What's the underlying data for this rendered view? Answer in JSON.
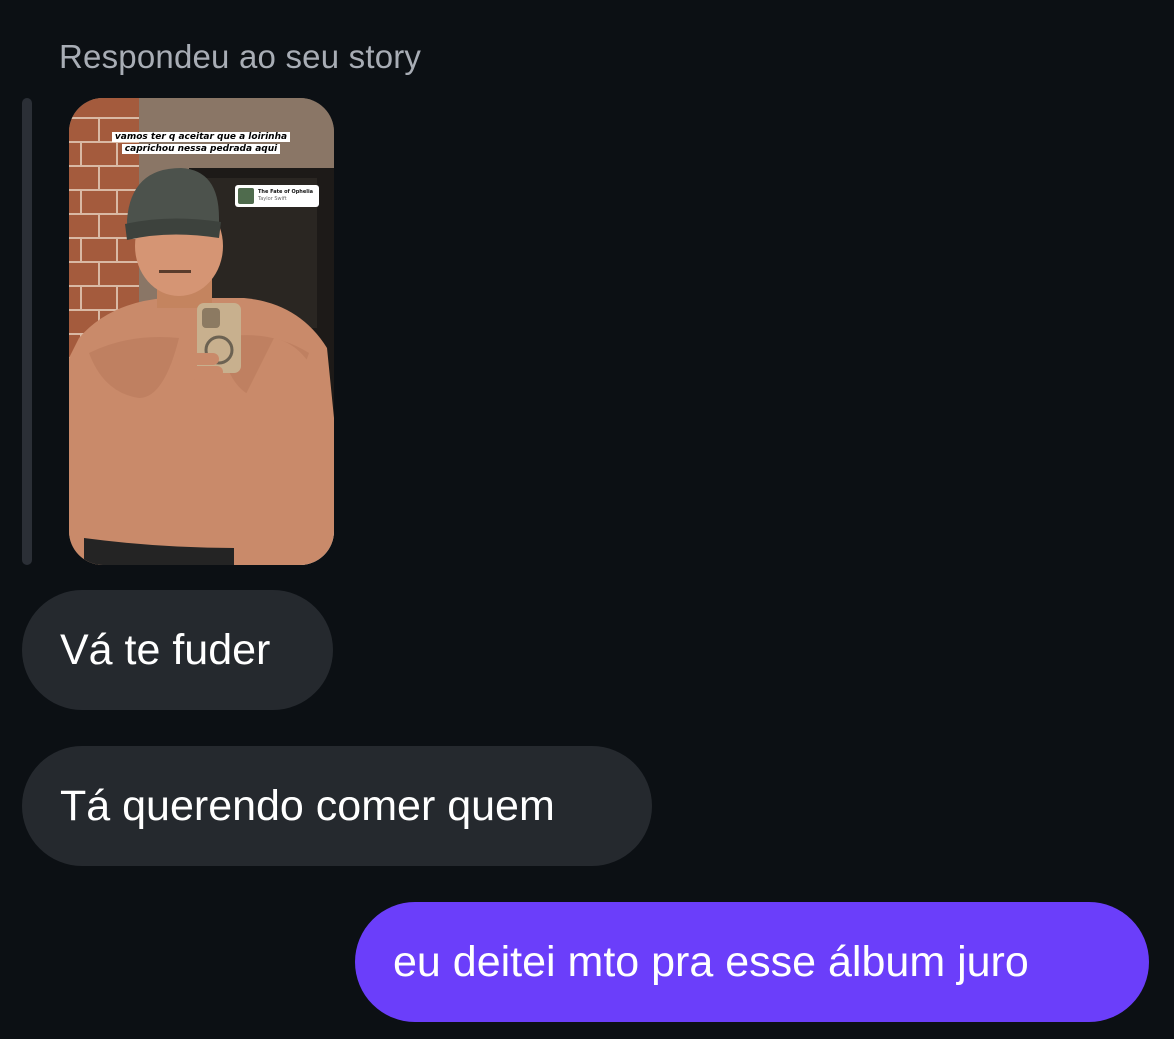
{
  "thread": {
    "reply_header": "Respondeu ao seu story",
    "story": {
      "caption_line1": "vamos ter q aceitar que a loirinha",
      "caption_line2": "caprichou nessa pedrada aqui",
      "music": {
        "title": "The Fate of Ophelia",
        "artist": "Taylor Swift"
      }
    },
    "messages": [
      {
        "text": "Vá te fuder",
        "direction": "incoming"
      },
      {
        "text": "Tá querendo comer quem",
        "direction": "incoming"
      },
      {
        "text": "eu deitei mto pra esse álbum juro",
        "direction": "outgoing"
      }
    ]
  },
  "colors": {
    "background": "#0c1014",
    "incoming_bubble": "#25292e",
    "outgoing_bubble": "#6b3efa",
    "header_text": "#a8adb5"
  }
}
